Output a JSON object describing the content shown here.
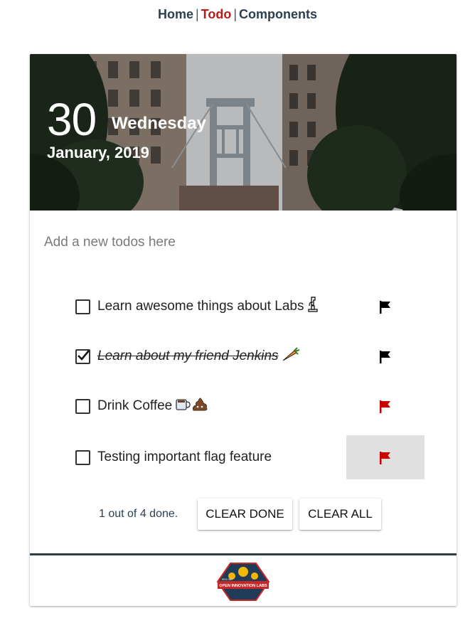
{
  "nav": {
    "home": "Home",
    "todo": "Todo",
    "components": "Components",
    "separator": "|"
  },
  "header": {
    "day": "30",
    "weekday": "Wednesday",
    "month_year": "January, 2019"
  },
  "new_todo": {
    "placeholder": "Add a new todos here"
  },
  "todos": [
    {
      "label": "Learn awesome things about Labs",
      "done": false,
      "important": false,
      "emoji_icon": "microscope-icon"
    },
    {
      "label": "Learn about my friend Jenkins",
      "done": true,
      "important": false,
      "emoji_icon": "carrot-icon"
    },
    {
      "label": "Drink Coffee",
      "done": false,
      "important": true,
      "emoji_icon": "coffee-and-poop-icon"
    },
    {
      "label": "Testing important flag feature",
      "done": false,
      "important": true,
      "emoji_icon": ""
    }
  ],
  "summary": "1 out of 4 done.",
  "buttons": {
    "clear_done": "CLEAR DONE",
    "clear_all": "CLEAR ALL"
  },
  "footer": {
    "logo_line1": "RED HAT",
    "logo_line2": "OPEN INNOVATION LABS"
  },
  "colors": {
    "active_nav": "#b71c1c",
    "flag_default": "#000000",
    "flag_important": "#cc0000",
    "footer_rule": "#2f3e46"
  }
}
